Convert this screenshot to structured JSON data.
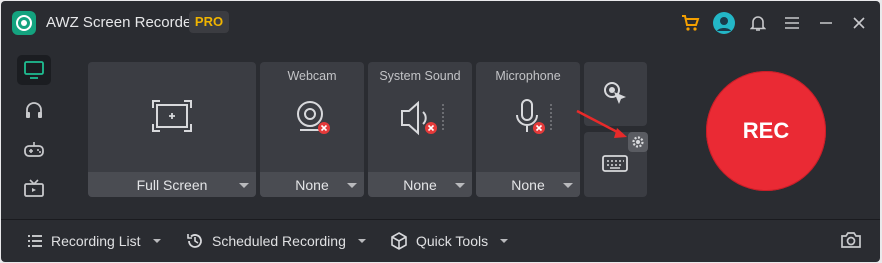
{
  "window": {
    "title": "AWZ Screen Recorder",
    "badge": "PRO"
  },
  "titlebar_icons": [
    "cart-icon",
    "user-avatar-icon",
    "bell-icon",
    "menu-icon",
    "minimize-icon",
    "close-icon"
  ],
  "sidebar": {
    "items": [
      {
        "icon": "monitor-icon",
        "active": true
      },
      {
        "icon": "headphones-icon",
        "active": false
      },
      {
        "icon": "gamepad-icon",
        "active": false
      },
      {
        "icon": "tv-icon",
        "active": false
      }
    ]
  },
  "panels": {
    "screen": {
      "value": "Full Screen"
    },
    "webcam": {
      "label": "Webcam",
      "value": "None"
    },
    "system_sound": {
      "label": "System Sound",
      "value": "None"
    },
    "microphone": {
      "label": "Microphone",
      "value": "None"
    }
  },
  "tools": [
    "cursor-click-icon",
    "keyboard-icon",
    "settings-gear-icon"
  ],
  "rec_button": {
    "label": "REC"
  },
  "bottombar": {
    "recording_list": "Recording List",
    "scheduled_recording": "Scheduled Recording",
    "quick_tools": "Quick Tools"
  },
  "colors": {
    "accent_green": "#14a37f",
    "rec_red": "#ea2a34",
    "badge_gold": "#f0b400",
    "cart_orange": "#f5a000",
    "muted_red": "#e53a3a"
  }
}
